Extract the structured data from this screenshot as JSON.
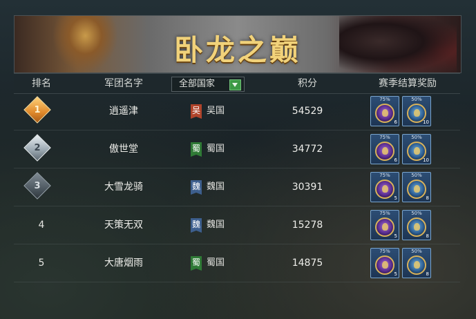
{
  "title": "卧龙之巅",
  "columns": {
    "rank": "排名",
    "name": "军团名字",
    "nation_filter": "全部国家",
    "score": "积分",
    "reward": "赛季结算奖励"
  },
  "rows": [
    {
      "rank": "1",
      "name": "逍遥津",
      "flag": "吴",
      "nation": "吴国",
      "score": "54529",
      "rewards": [
        {
          "pct": "75%",
          "count": "6"
        },
        {
          "pct": "50%",
          "count": "10"
        }
      ]
    },
    {
      "rank": "2",
      "name": "傲世堂",
      "flag": "蜀",
      "nation": "蜀国",
      "score": "34772",
      "rewards": [
        {
          "pct": "75%",
          "count": "6"
        },
        {
          "pct": "50%",
          "count": "10"
        }
      ]
    },
    {
      "rank": "3",
      "name": "大雪龙骑",
      "flag": "魏",
      "nation": "魏国",
      "score": "30391",
      "rewards": [
        {
          "pct": "75%",
          "count": "5"
        },
        {
          "pct": "50%",
          "count": "8"
        }
      ]
    },
    {
      "rank": "4",
      "name": "天策无双",
      "flag": "魏",
      "nation": "魏国",
      "score": "15278",
      "rewards": [
        {
          "pct": "75%",
          "count": "5"
        },
        {
          "pct": "50%",
          "count": "8"
        }
      ]
    },
    {
      "rank": "5",
      "name": "大唐烟雨",
      "flag": "蜀",
      "nation": "蜀国",
      "score": "14875",
      "rewards": [
        {
          "pct": "75%",
          "count": "5"
        },
        {
          "pct": "50%",
          "count": "8"
        }
      ]
    }
  ],
  "colors": {
    "wu": "#b0442b",
    "shu": "#2f7a36",
    "wei": "#3d5f8e",
    "gold": "#f1d27a"
  }
}
